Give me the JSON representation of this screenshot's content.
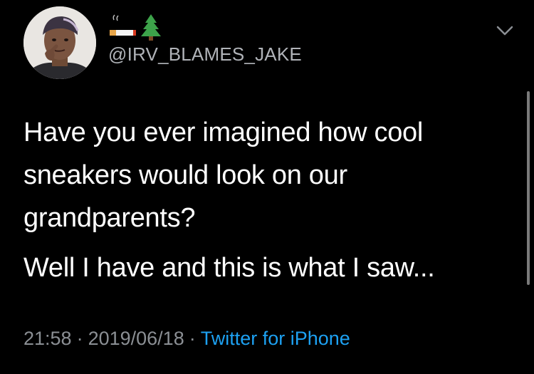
{
  "tweet": {
    "display_name_emojis": [
      "cigarette-emoji",
      "evergreen-tree-emoji"
    ],
    "handle": "@IRV_BLAMES_JAKE",
    "text_line_1": "Have you ever imagined how cool sneakers would look on our grandparents?",
    "text_line_2": "Well I have and this is what I saw...",
    "time": "21:58",
    "separator": "·",
    "date": "2019/06/18",
    "source": "Twitter for iPhone"
  },
  "icons": {
    "menu": "chevron-down-icon"
  },
  "colors": {
    "background": "#000000",
    "text": "#ffffff",
    "secondary_text": "#8b8f94",
    "link": "#1da1f2"
  }
}
